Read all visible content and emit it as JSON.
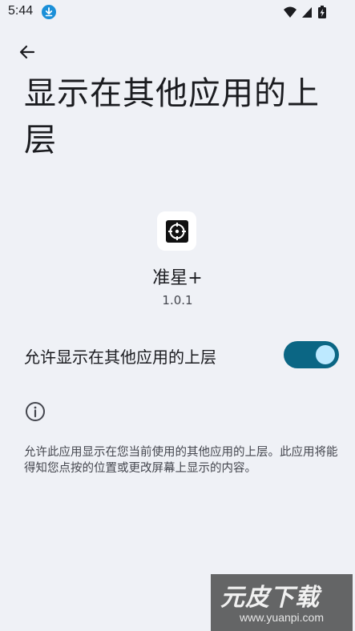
{
  "status_bar": {
    "time": "5:44",
    "icons": [
      "download-icon",
      "wifi-icon",
      "cell-signal-icon",
      "battery-charging-icon"
    ]
  },
  "header": {
    "back_icon": "arrow-left-icon",
    "title": "显示在其他应用的上层"
  },
  "app": {
    "icon": "crosshair-app-icon",
    "name": "准星+",
    "version": "1.0.1"
  },
  "permission": {
    "label": "允许显示在其他应用的上层",
    "enabled": true
  },
  "info": {
    "icon": "info-icon",
    "description": "允许此应用显示在您当前使用的其他应用的上层。此应用将能得知您点按的位置或更改屏幕上显示的内容。"
  },
  "colors": {
    "background": "#eff1f6",
    "toggle_track": "#0b6684",
    "toggle_knob": "#bde9ff",
    "download_badge": "#1a8fd8"
  },
  "watermark": {
    "logo": "元皮下载",
    "url": "www.yuanpi.com"
  }
}
